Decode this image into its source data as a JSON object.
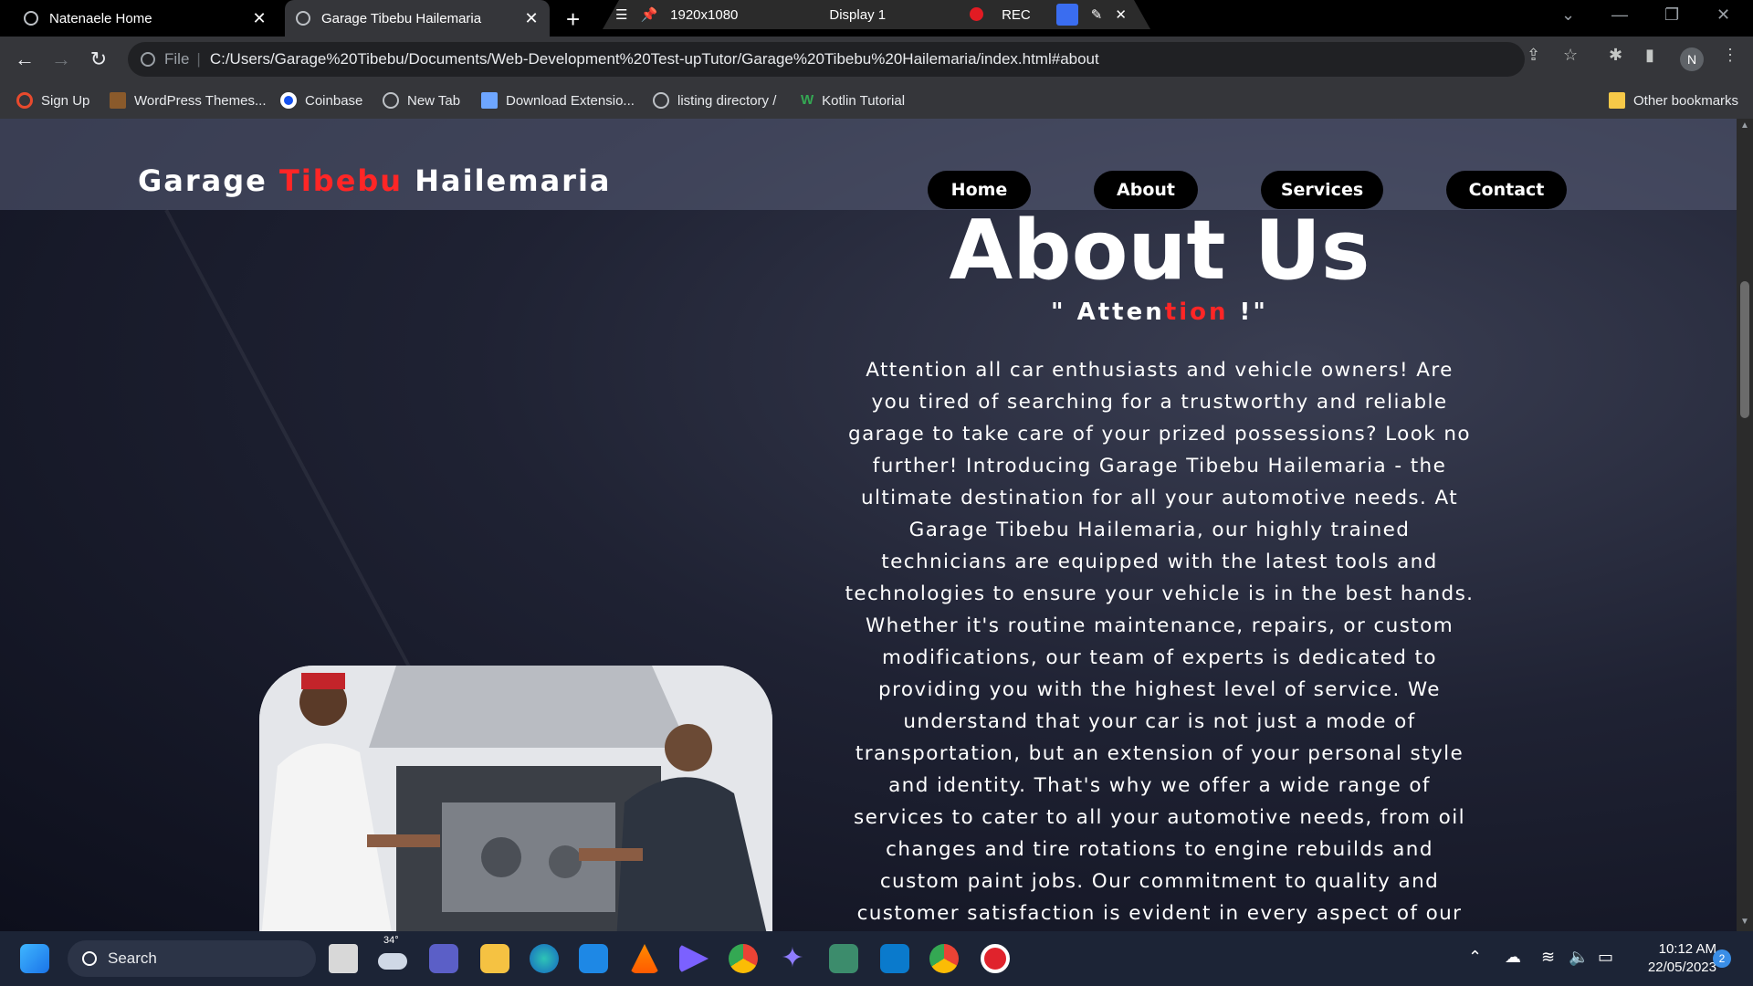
{
  "browser": {
    "tabs": [
      {
        "title": "Natenaele Home"
      },
      {
        "title": "Garage Tibebu Hailemaria"
      }
    ],
    "recorder": {
      "resolution": "1920x1080",
      "display": "Display 1",
      "rec_label": "REC"
    },
    "address": {
      "scheme_label": "File",
      "url": "C:/Users/Garage%20Tibebu/Documents/Web-Development%20Test-upTutor/Garage%20Tibebu%20Hailemaria/index.html#about"
    },
    "profile_initial": "N",
    "bookmarks": [
      {
        "label": "Sign Up"
      },
      {
        "label": "WordPress Themes..."
      },
      {
        "label": "Coinbase"
      },
      {
        "label": "New Tab"
      },
      {
        "label": "Download Extensio..."
      },
      {
        "label": "listing directory /"
      },
      {
        "label": "Kotlin Tutorial"
      }
    ],
    "other_bookmarks": "Other bookmarks"
  },
  "site": {
    "logo": {
      "part1": "Garage ",
      "part2": "Tibebu",
      "part3": " Hailemaria"
    },
    "nav": [
      {
        "label": "Home"
      },
      {
        "label": "About"
      },
      {
        "label": "Services"
      },
      {
        "label": "Contact"
      }
    ],
    "about": {
      "title": "About Us",
      "tagline": {
        "open": "\" Atten",
        "highlight": "tion",
        "close": " !\""
      },
      "body": "Attention all car enthusiasts and vehicle owners! Are you tired of searching for a trustworthy and reliable garage to take care of your prized possessions? Look no further! Introducing Garage Tibebu Hailemaria - the ultimate destination for all your automotive needs. At Garage Tibebu Hailemaria, our highly trained technicians are equipped with the latest tools and technologies to ensure your vehicle is in the best hands. Whether it's routine maintenance, repairs, or custom modifications, our team of experts is dedicated to providing you with the highest level of service. We understand that your car is not just a mode of transportation, but an extension of your personal style and identity. That's why we offer a wide range of services to cater to all your automotive needs, from oil changes and tire rotations to engine rebuilds and custom paint jobs. Our commitment to quality and customer satisfaction is evident in every aspect of our business, and we go above and beyond to ensure your experience with us is nothing short of"
    }
  },
  "taskbar": {
    "search_label": "Search",
    "weather_temp": "34°",
    "time": "10:12 AM",
    "date": "22/05/2023",
    "notification_count": "2"
  },
  "colors": {
    "accent_red": "#ff2626",
    "nav_pill": "#000000",
    "taskbar": "#1c2436"
  }
}
